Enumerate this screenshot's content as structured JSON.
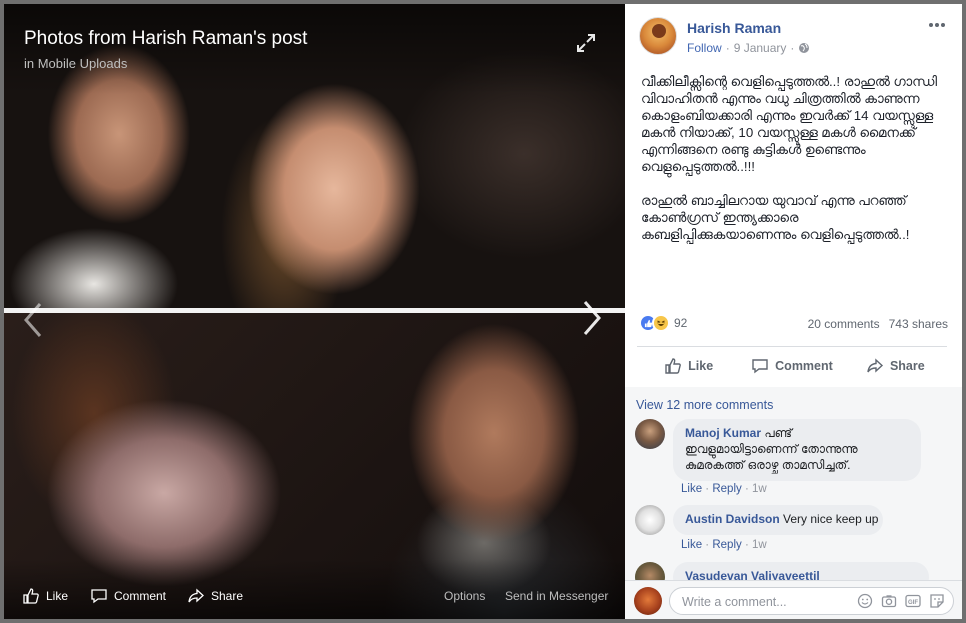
{
  "viewer": {
    "title": "Photos from Harish Raman's post",
    "album": "in Mobile Uploads",
    "bar": {
      "like": "Like",
      "comment": "Comment",
      "share": "Share",
      "options": "Options",
      "send": "Send in Messenger"
    }
  },
  "post": {
    "author": "Harish Raman",
    "follow": "Follow",
    "date": "9 January",
    "paragraph1": "വീക്കിലീക്സിന്റെ വെളിപ്പെടുത്തൽ..! രാഹുൽ ഗാന്ധി വിവാഹിതൻ എന്നും വധു ചിത്രത്തിൽ കാണുന്ന കൊളംബിയക്കാരി എന്നും ഇവർക്ക് 14 വയസ്സുള്ള മകൻ നിയാക്ക്, 10 വയസ്സുള്ള മകൾ മൈനക്ക് എന്നിങ്ങനെ രണ്ടു കുട്ടികൾ ഉണ്ടെന്നും വെളുപ്പെടുത്തൽ..!!!",
    "paragraph2": "രാഹുൽ ബാച്ചിലറായ യുവാവ് എന്നു പറഞ്ഞ് കോൺഗ്രസ് ഇന്ത്യക്കാരെ കബളിപ്പിക്കുകയാണെന്നും വെളിപ്പെടുത്തൽ..!",
    "reaction_count": "92",
    "comments_count": "20 comments",
    "shares_count": "743 shares",
    "actions": {
      "like": "Like",
      "comment": "Comment",
      "share": "Share"
    }
  },
  "comments": {
    "view_more": "View 12 more comments",
    "items": [
      {
        "name": "Manoj Kumar",
        "text_line1": "പണ്ട്",
        "text_line2": "ഇവളുമായിട്ടാണെന്ന് തോന്നുന്നു",
        "text_line3": "കുമരകത്ത് ഒരാഴ്ച താമസിച്ചത്.",
        "like": "Like",
        "reply": "Reply",
        "time": "1w"
      },
      {
        "name": "Austin Davidson",
        "text": "Very nice keep up",
        "like": "Like",
        "reply": "Reply",
        "time": "1w"
      },
      {
        "name": "Vasudevan Valiyaveettil"
      }
    ],
    "composer_placeholder": "Write a comment..."
  },
  "colors": {
    "link": "#385898",
    "follow": "#4267b2",
    "like_reaction": "#4a7bf0",
    "haha_reaction": "#f7c64a"
  },
  "icons": [
    "expand-icon",
    "chevron-left-icon",
    "chevron-right-icon",
    "like-icon",
    "comment-icon",
    "share-icon",
    "globe-icon",
    "more-icon",
    "emoji-icon",
    "camera-icon",
    "gif-icon",
    "sticker-icon"
  ]
}
